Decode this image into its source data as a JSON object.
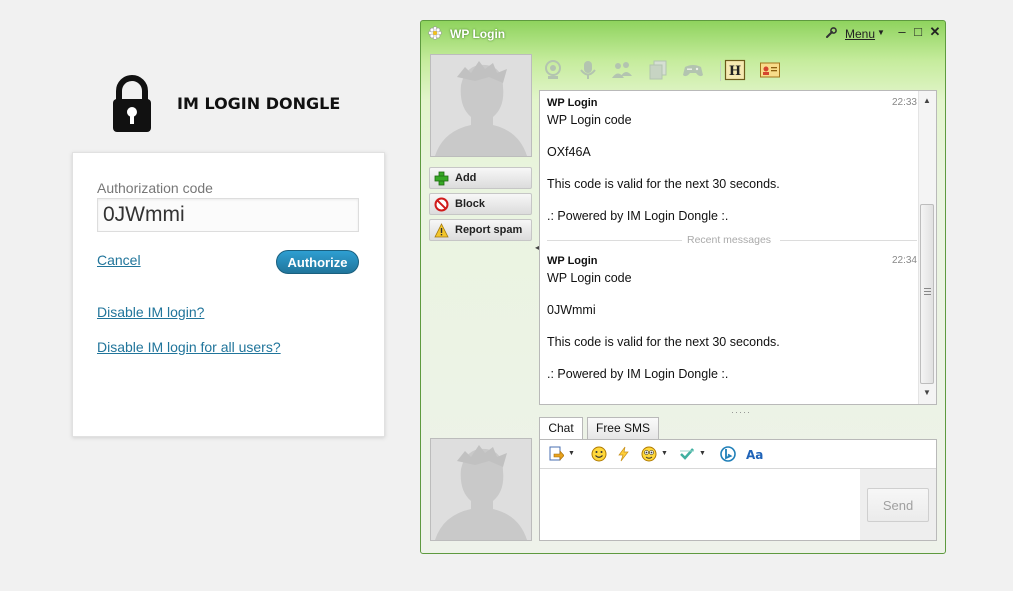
{
  "login": {
    "brand": "IM LOGIN DONGLE",
    "auth_label": "Authorization code",
    "auth_value": "0JWmmi",
    "cancel_label": "Cancel",
    "authorize_label": "Authorize",
    "disable_label": "Disable IM login?",
    "disable_all_label": "Disable IM login for all users?",
    "link_color": "#21759b",
    "button_color": "#21759b"
  },
  "chat_window": {
    "title": "WP Login",
    "menu_label": "Menu",
    "accent_color": "#8fd35e",
    "toolbar_icons": [
      "webcam-icon",
      "microphone-icon",
      "group-chat-icon",
      "copy-icon",
      "gamepad-icon",
      "history-icon",
      "contact-card-icon"
    ],
    "history_icon_glyph": "H",
    "side_buttons": {
      "add": "Add",
      "block": "Block",
      "report_spam": "Report spam"
    },
    "messages": [
      {
        "sender": "WP Login",
        "time": "22:33",
        "lines": [
          "WP Login code",
          "OXf46A",
          "This code is valid for the next 30 seconds.",
          ".: Powered by IM Login Dongle :."
        ]
      },
      {
        "sender": "WP Login",
        "time": "22:34",
        "lines": [
          "WP Login code",
          "0JWmmi",
          "This code is valid for the next 30 seconds.",
          ".: Powered by IM Login Dongle :."
        ]
      }
    ],
    "recent_label": "Recent messages",
    "tabs": {
      "chat": "Chat",
      "free_sms": "Free SMS"
    },
    "compose_icons": [
      "send-file-icon",
      "smiley-icon",
      "flash-icon",
      "wink-icon",
      "checkmark-icon",
      "bing-icon",
      "font-icon"
    ],
    "font_icon_glyph": "Aa",
    "send_label": "Send"
  }
}
